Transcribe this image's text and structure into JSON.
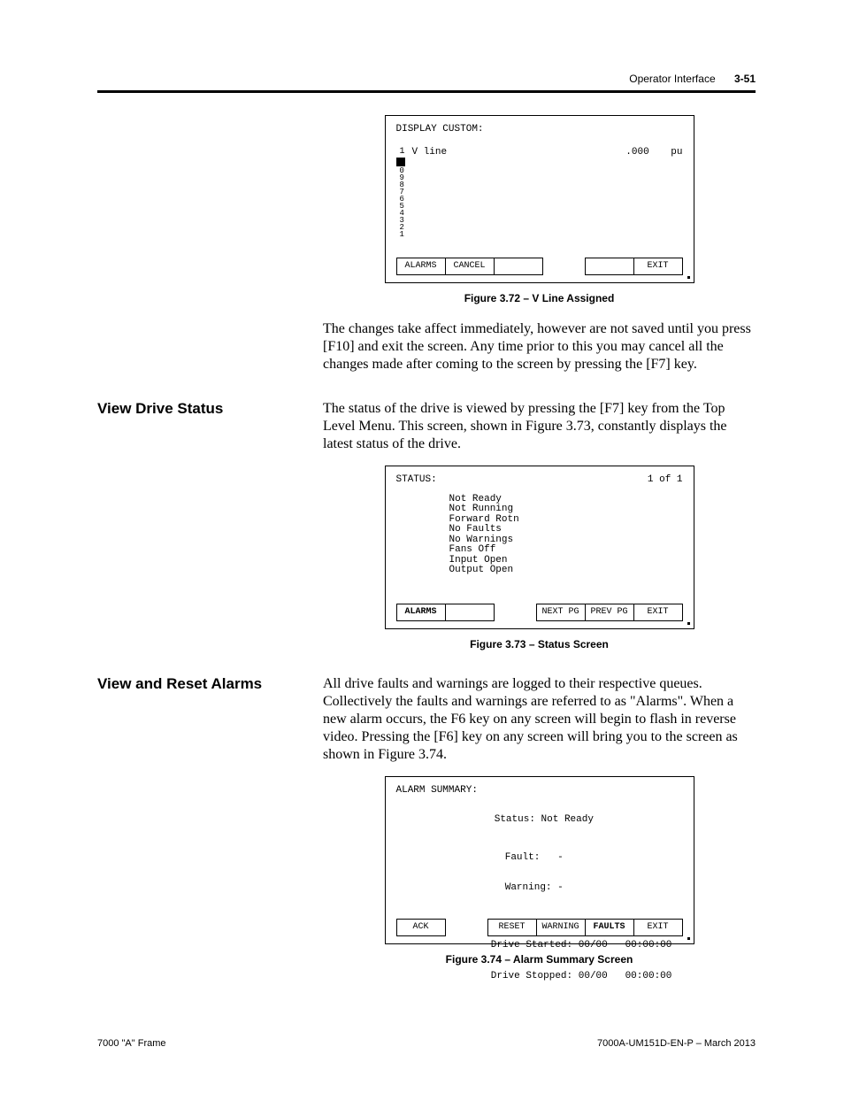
{
  "header": {
    "chapter": "Operator Interface",
    "page": "3-51"
  },
  "fig72": {
    "screen": {
      "title": "DISPLAY CUSTOM:",
      "sideDigits": "0987654321",
      "itemLabel": "V line",
      "value": ".000",
      "unit": "pu",
      "buttons": {
        "alarms": "ALARMS",
        "cancel": "CANCEL",
        "exit": "EXIT"
      }
    },
    "caption": "Figure 3.72 – V Line Assigned"
  },
  "para1": "The changes take affect immediately, however are not saved until you press [F10] and exit the screen.  Any time prior to this you may cancel all the changes made after coming to the screen by pressing the [F7] key.",
  "section1": {
    "heading": "View Drive Status",
    "para": "The status of the drive is viewed by pressing the [F7] key from the Top Level Menu.  This screen, shown in Figure 3.73, constantly displays the latest status of the drive."
  },
  "fig73": {
    "screen": {
      "title": "STATUS:",
      "pageOf": "1 of  1",
      "lines": "Not Ready\nNot Running\nForward Rotn\nNo Faults\nNo Warnings\nFans Off\nInput Open\nOutput Open",
      "buttons": {
        "alarms": "ALARMS",
        "next": "NEXT PG",
        "prev": "PREV PG",
        "exit": "EXIT"
      }
    },
    "caption": "Figure 3.73 – Status Screen"
  },
  "section2": {
    "heading": "View and Reset Alarms",
    "para": "All drive faults and warnings are logged to their respective queues. Collectively the faults and warnings are referred to as \"Alarms\".  When a new alarm occurs, the F6 key on any screen will begin to flash in reverse video.  Pressing the [F6] key on any screen will bring you to the screen as shown in Figure 3.74."
  },
  "fig74": {
    "screen": {
      "title": "ALARM SUMMARY:",
      "statusLabel": "Status:",
      "statusValue": "Not Ready",
      "faultLabel": "Fault:",
      "faultValue": "-",
      "warningLabel": "Warning:",
      "warningValue": "-",
      "startedLabel": "Drive Started:",
      "startedDate": "00/00",
      "startedTime": "00:00:00",
      "stoppedLabel": "Drive Stopped:",
      "stoppedDate": "00/00",
      "stoppedTime": "00:00:00",
      "buttons": {
        "ack": "ACK",
        "reset": "RESET",
        "warning": "WARNING",
        "faults": "FAULTS",
        "exit": "EXIT"
      }
    },
    "caption": "Figure 3.74 – Alarm Summary Screen"
  },
  "footer": {
    "left": "7000 \"A\" Frame",
    "right": "7000A-UM151D-EN-P – March 2013"
  }
}
